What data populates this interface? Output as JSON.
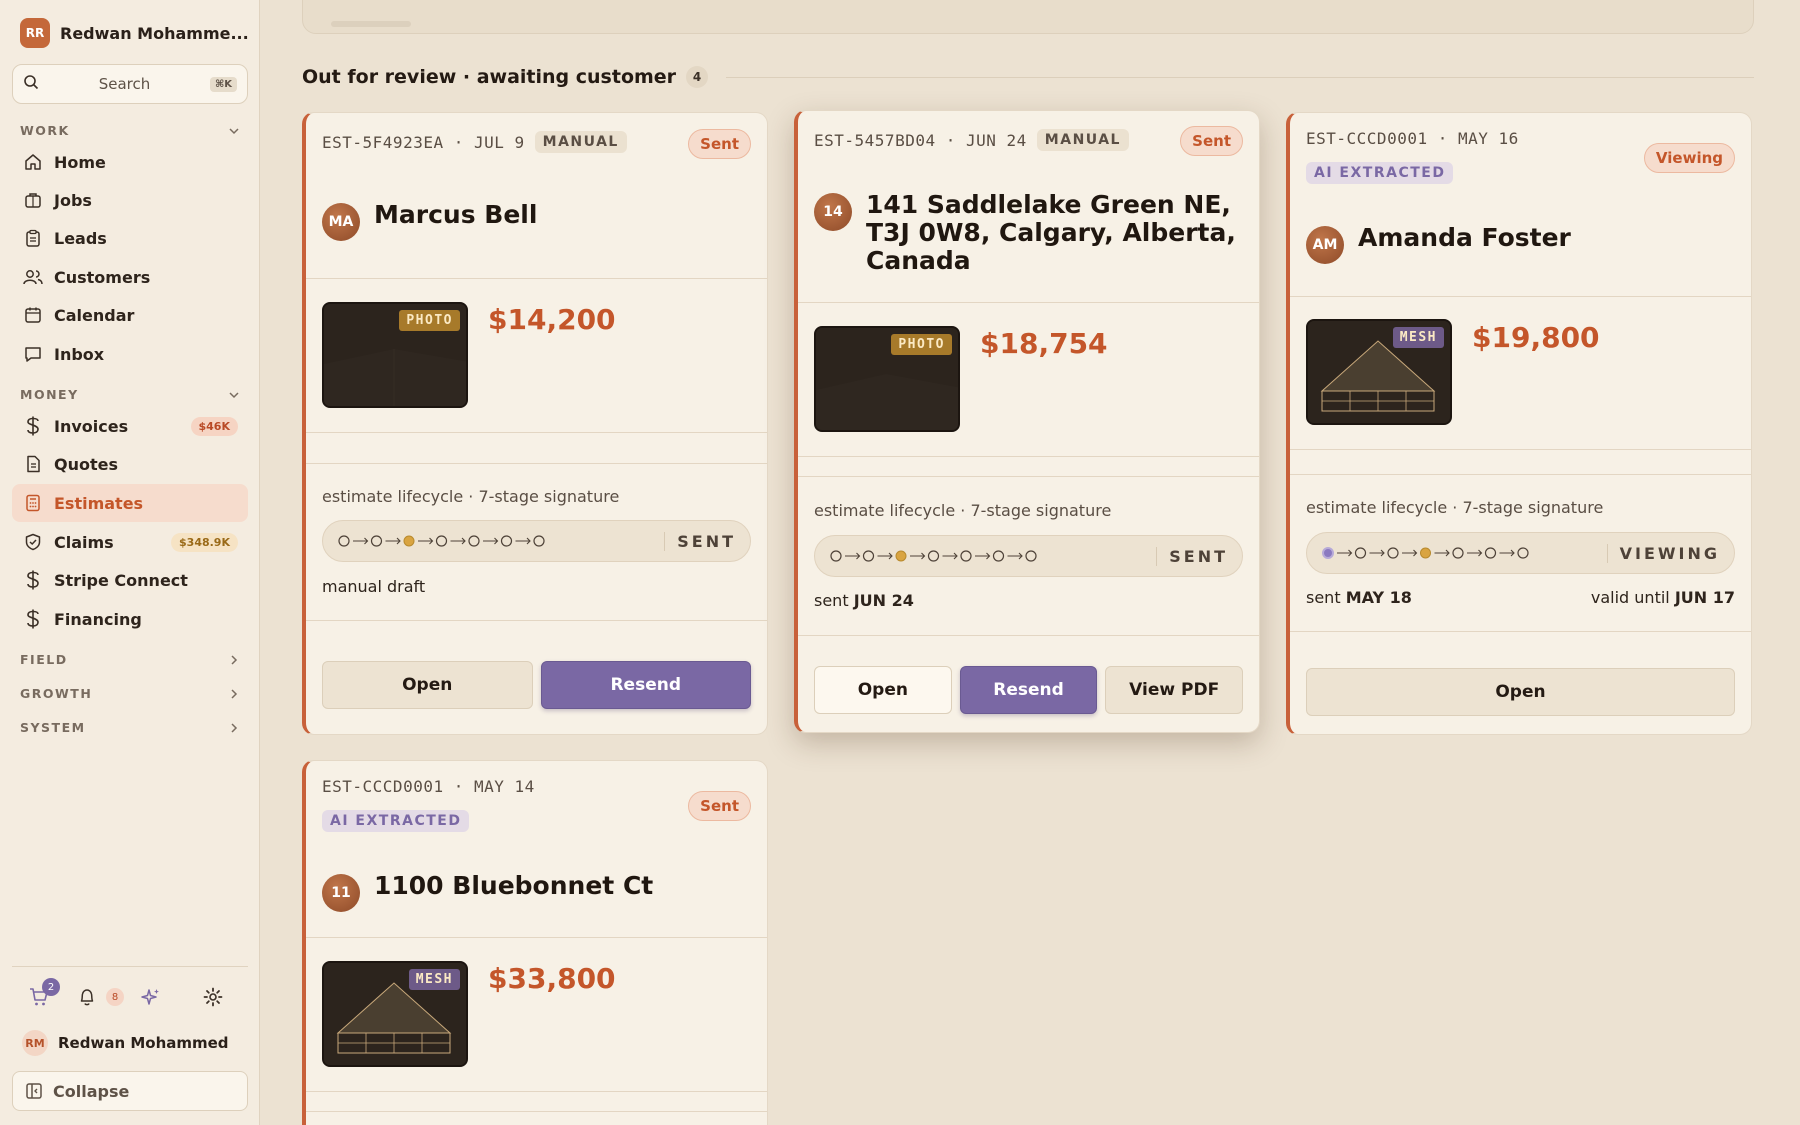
{
  "sidebar": {
    "workspace": {
      "initials": "RR",
      "name": "Redwan Mohamme..."
    },
    "search": {
      "label": "Search",
      "shortcut": "⌘K"
    },
    "sections": {
      "work": "WORK",
      "money": "MONEY",
      "field": "FIELD",
      "growth": "GROWTH",
      "system": "SYSTEM"
    },
    "work_items": [
      {
        "label": "Home",
        "icon": "home-icon"
      },
      {
        "label": "Jobs",
        "icon": "briefcase-icon"
      },
      {
        "label": "Leads",
        "icon": "clipboard-icon"
      },
      {
        "label": "Customers",
        "icon": "users-icon"
      },
      {
        "label": "Calendar",
        "icon": "calendar-icon"
      },
      {
        "label": "Inbox",
        "icon": "message-icon"
      }
    ],
    "money_items": [
      {
        "label": "Invoices",
        "icon": "dollar-icon",
        "badge": "$46K"
      },
      {
        "label": "Quotes",
        "icon": "document-icon"
      },
      {
        "label": "Estimates",
        "icon": "calculator-icon",
        "active": true
      },
      {
        "label": "Claims",
        "icon": "shield-icon",
        "badge": "$348.9K"
      },
      {
        "label": "Stripe Connect",
        "icon": "dollar-icon"
      },
      {
        "label": "Financing",
        "icon": "dollar-icon"
      }
    ],
    "tray": {
      "cart_count": "2",
      "notifications_count": "8"
    },
    "user": {
      "initials": "RM",
      "name": "Redwan Mohammed"
    },
    "collapse_label": "Collapse"
  },
  "group": {
    "title": "Out for review · awaiting customer",
    "count": "4"
  },
  "cards": [
    {
      "id": "EST-5F4923EA · JUL 9",
      "tag": "MANUAL",
      "status": "Sent",
      "avatar": "MA",
      "name": "Marcus Bell",
      "thumb_tag": "PHOTO",
      "price": "$14,200",
      "lifecycle_label": "estimate lifecycle · 7-stage signature",
      "lifecycle_state": "SENT",
      "note_left": "manual draft",
      "buttons": {
        "open": "Open",
        "resend": "Resend"
      }
    },
    {
      "id": "EST-5457BD04 · JUN 24",
      "tag": "MANUAL",
      "status": "Sent",
      "avatar": "14",
      "name": "141 Saddlelake Green NE, T3J 0W8, Calgary, Alberta, Canada",
      "thumb_tag": "PHOTO",
      "price": "$18,754",
      "lifecycle_label": "estimate lifecycle · 7-stage signature",
      "lifecycle_state": "SENT",
      "note_prefix": "sent",
      "note_date": "JUN 24",
      "buttons": {
        "open": "Open",
        "resend": "Resend",
        "pdf": "View PDF"
      }
    },
    {
      "id": "EST-CCCD0001 · MAY 16",
      "tag": "AI EXTRACTED",
      "status": "Viewing",
      "avatar": "AM",
      "name": "Amanda Foster",
      "thumb_tag": "MESH",
      "price": "$19,800",
      "lifecycle_label": "estimate lifecycle · 7-stage signature",
      "lifecycle_state": "VIEWING",
      "note_prefix": "sent",
      "note_date": "MAY 18",
      "valid_prefix": "valid until",
      "valid_date": "JUN 17",
      "buttons": {
        "open": "Open"
      }
    },
    {
      "id": "EST-CCCD0001 · MAY 14",
      "tag": "AI EXTRACTED",
      "status": "Sent",
      "avatar": "11",
      "name": "1100 Bluebonnet Ct",
      "thumb_tag": "MESH",
      "price": "$33,800"
    }
  ],
  "colors": {
    "accent": "#c4562a",
    "primary_button": "#7a68a4",
    "stage_current": "#d9a441",
    "stage_viewed": "#8b7ac0"
  }
}
